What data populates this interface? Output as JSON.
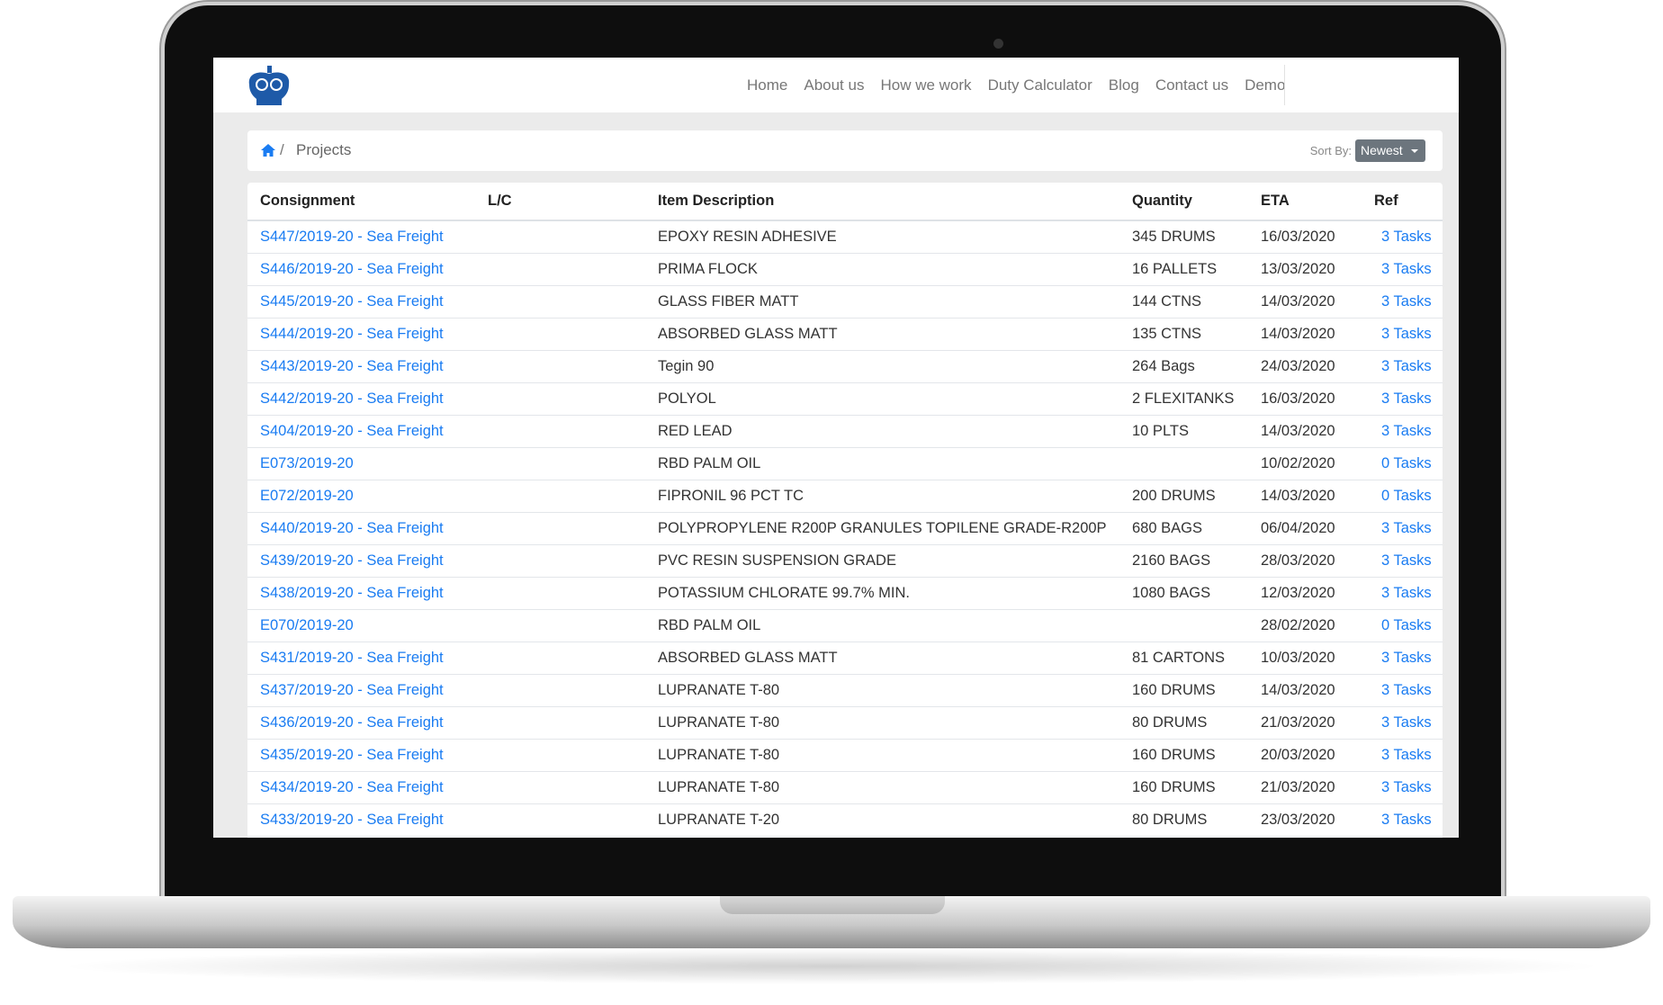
{
  "nav": {
    "items": [
      "Home",
      "About us",
      "How we work",
      "Duty Calculator",
      "Blog",
      "Contact us",
      "Demo"
    ]
  },
  "breadcrumb": {
    "home_icon": "home-icon",
    "separator": "/",
    "current": "Projects"
  },
  "sort": {
    "label": "Sort By:",
    "value": "Newest"
  },
  "colors": {
    "link": "#1a7cf2",
    "sort_button": "#6c757d",
    "logo": "#1e5aa8"
  },
  "table": {
    "headers": [
      "Consignment",
      "L/C",
      "Item Description",
      "Quantity",
      "ETA",
      "Ref"
    ],
    "rows": [
      {
        "consignment": "S447/2019-20 - Sea Freight",
        "lc": "",
        "item": "EPOXY RESIN ADHESIVE",
        "quantity": "345 DRUMS",
        "eta": "16/03/2020",
        "ref": "3 Tasks"
      },
      {
        "consignment": "S446/2019-20 - Sea Freight",
        "lc": "",
        "item": "PRIMA FLOCK",
        "quantity": "16 PALLETS",
        "eta": "13/03/2020",
        "ref": "3 Tasks"
      },
      {
        "consignment": "S445/2019-20 - Sea Freight",
        "lc": "",
        "item": "GLASS FIBER MATT",
        "quantity": "144 CTNS",
        "eta": "14/03/2020",
        "ref": "3 Tasks"
      },
      {
        "consignment": "S444/2019-20 - Sea Freight",
        "lc": "",
        "item": "ABSORBED GLASS MATT",
        "quantity": "135 CTNS",
        "eta": "14/03/2020",
        "ref": "3 Tasks"
      },
      {
        "consignment": "S443/2019-20 - Sea Freight",
        "lc": "",
        "item": "Tegin 90",
        "quantity": "264 Bags",
        "eta": "24/03/2020",
        "ref": "3 Tasks"
      },
      {
        "consignment": "S442/2019-20 - Sea Freight",
        "lc": "",
        "item": "POLYOL",
        "quantity": "2 FLEXITANKS",
        "eta": "16/03/2020",
        "ref": "3 Tasks"
      },
      {
        "consignment": "S404/2019-20 - Sea Freight",
        "lc": "",
        "item": "RED LEAD",
        "quantity": "10 PLTS",
        "eta": "14/03/2020",
        "ref": "3 Tasks"
      },
      {
        "consignment": "E073/2019-20",
        "lc": "",
        "item": "RBD PALM OIL",
        "quantity": "",
        "eta": "10/02/2020",
        "ref": "0 Tasks"
      },
      {
        "consignment": "E072/2019-20",
        "lc": "",
        "item": "FIPRONIL 96 PCT TC",
        "quantity": "200 DRUMS",
        "eta": "14/03/2020",
        "ref": "0 Tasks"
      },
      {
        "consignment": "S440/2019-20 - Sea Freight",
        "lc": "",
        "item": "POLYPROPYLENE R200P GRANULES TOPILENE GRADE-R200P",
        "quantity": "680 BAGS",
        "eta": "06/04/2020",
        "ref": "3 Tasks"
      },
      {
        "consignment": "S439/2019-20 - Sea Freight",
        "lc": "",
        "item": "PVC RESIN SUSPENSION GRADE",
        "quantity": "2160 BAGS",
        "eta": "28/03/2020",
        "ref": "3 Tasks"
      },
      {
        "consignment": "S438/2019-20 - Sea Freight",
        "lc": "",
        "item": "POTASSIUM CHLORATE 99.7% MIN.",
        "quantity": "1080 BAGS",
        "eta": "12/03/2020",
        "ref": "3 Tasks"
      },
      {
        "consignment": "E070/2019-20",
        "lc": "",
        "item": "RBD PALM OIL",
        "quantity": "",
        "eta": "28/02/2020",
        "ref": "0 Tasks"
      },
      {
        "consignment": "S431/2019-20 - Sea Freight",
        "lc": "",
        "item": "ABSORBED GLASS MATT",
        "quantity": "81 CARTONS",
        "eta": "10/03/2020",
        "ref": "3 Tasks"
      },
      {
        "consignment": "S437/2019-20 - Sea Freight",
        "lc": "",
        "item": "LUPRANATE T-80",
        "quantity": "160 DRUMS",
        "eta": "14/03/2020",
        "ref": "3 Tasks"
      },
      {
        "consignment": "S436/2019-20 - Sea Freight",
        "lc": "",
        "item": "LUPRANATE T-80",
        "quantity": "80 DRUMS",
        "eta": "21/03/2020",
        "ref": "3 Tasks"
      },
      {
        "consignment": "S435/2019-20 - Sea Freight",
        "lc": "",
        "item": "LUPRANATE T-80",
        "quantity": "160 DRUMS",
        "eta": "20/03/2020",
        "ref": "3 Tasks"
      },
      {
        "consignment": "S434/2019-20 - Sea Freight",
        "lc": "",
        "item": "LUPRANATE T-80",
        "quantity": "160 DRUMS",
        "eta": "21/03/2020",
        "ref": "3 Tasks"
      },
      {
        "consignment": "S433/2019-20 - Sea Freight",
        "lc": "",
        "item": "LUPRANATE T-20",
        "quantity": "80 DRUMS",
        "eta": "23/03/2020",
        "ref": "3 Tasks"
      }
    ]
  }
}
